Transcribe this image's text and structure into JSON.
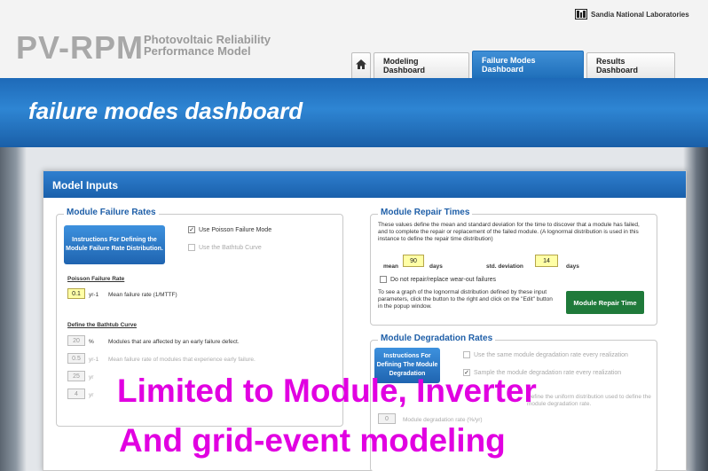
{
  "header": {
    "logo_main": "PV-RPM",
    "logo_sub_line1": "Photovoltaic Reliability",
    "logo_sub_line2": "Performance Model",
    "org_name": "Sandia National Laboratories",
    "org_icon": "sandia-logo-icon"
  },
  "tabs": [
    {
      "label": "",
      "icon": "home-icon",
      "active": false
    },
    {
      "label": "Modeling Dashboard",
      "active": false
    },
    {
      "label": "Failure Modes Dashboard",
      "active": true
    },
    {
      "label": "Results Dashboard",
      "active": false
    }
  ],
  "banner": {
    "title": "failure modes dashboard"
  },
  "panel": {
    "title": "Model Inputs",
    "failure_rates": {
      "legend": "Module Failure Rates",
      "instructions_button": "Instructions For Defining the Module Failure Rate Distribution.",
      "use_poisson": {
        "label": "Use Poisson Failure Mode",
        "checked": true
      },
      "use_bathtub": {
        "label": "Use the Bathtub Curve",
        "checked": false
      },
      "poisson_heading": "Poisson Failure Rate",
      "poisson_value": "0.1",
      "poisson_unit": "yr-1",
      "poisson_desc": "Mean failure rate (1/MTTF)",
      "bathtub_heading": "Define the Bathtub Curve",
      "bathtub_rows": [
        {
          "value": "20",
          "unit": "%",
          "desc": "Modules that are affected by an early failure defect."
        },
        {
          "value": "0.5",
          "unit": "yr-1",
          "desc": "Mean failure rate of modules that experience early failure."
        },
        {
          "value": "25",
          "unit": "yr",
          "desc": ""
        },
        {
          "value": "4",
          "unit": "yr",
          "desc": ""
        }
      ]
    },
    "repair_times": {
      "legend": "Module Repair Times",
      "description": "These values define the mean and standard deviation for the time to discover that a module has failed, and to complete the repair or replacement of the failed module. (A lognormal distribution is used in this instance to define the repair time distribution)",
      "mean_label": "mean",
      "mean_value": "90",
      "mean_unit": "days",
      "std_label": "std. deviation",
      "std_value": "14",
      "std_unit": "days",
      "no_repair": {
        "label": "Do not repair/replace wear-out failures",
        "checked": false
      },
      "graph_help": "To see a graph of the lognormal distribution defined by these input parameters, click the button to the right and click on the \"Edit\" button in the popup window.",
      "graph_button": "Module Repair Time"
    },
    "degradation": {
      "legend": "Module Degradation Rates",
      "instructions_button": "Instructions For Defining The Module Degradation",
      "same_rate": {
        "label": "Use the same module degradation rate every realization",
        "checked": false
      },
      "sample_rate": {
        "label": "Sample the module degradation rate every realization",
        "checked": true
      },
      "rate_value": "0",
      "rate_label": "Module degradation rate (%/yr)",
      "uniform_note": "Define the uniform distribution used to define the module degradation rate."
    }
  },
  "overlay": {
    "line1": "Limited to Module, Inverter",
    "line2": "And grid-event modeling",
    "color": "#e100e1"
  }
}
